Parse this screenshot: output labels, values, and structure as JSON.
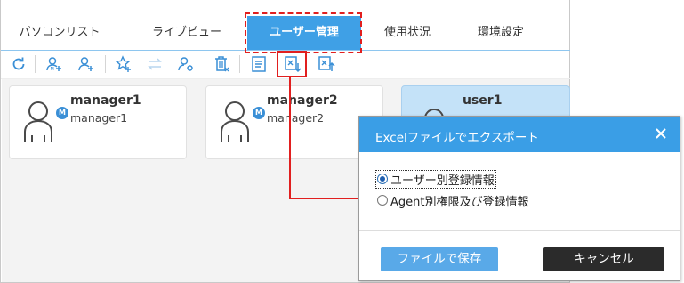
{
  "tabs": [
    {
      "label": "パソコンリスト",
      "active": false
    },
    {
      "label": "ライブビュー",
      "active": false
    },
    {
      "label": "ユーザー管理",
      "active": true
    },
    {
      "label": "使用状況",
      "active": false
    },
    {
      "label": "環境設定",
      "active": false
    }
  ],
  "toolbar": {
    "icons": [
      "refresh-icon",
      "add-manager-icon",
      "add-user-icon",
      "favorite-icon",
      "transfer-icon",
      "user-settings-icon",
      "delete-icon",
      "list-icon",
      "export-excel-icon",
      "import-excel-icon"
    ]
  },
  "cards": [
    {
      "name": "manager1",
      "sub": "manager1",
      "badge": "M",
      "selected": false
    },
    {
      "name": "manager2",
      "sub": "manager2",
      "badge": "M",
      "selected": false
    },
    {
      "name": "user1",
      "sub": "",
      "badge": "",
      "selected": true
    }
  ],
  "dialog": {
    "title": "Excelファイルでエクスポート",
    "options": [
      {
        "label": "ユーザー別登録情報",
        "checked": true
      },
      {
        "label": "Agent別権限及び登録情報",
        "checked": false
      }
    ],
    "save_label": "ファイルで保存",
    "cancel_label": "キャンセル"
  },
  "colors": {
    "accent": "#3fa0e6",
    "highlight": "#e11f1f",
    "selected_card": "#c4e2f8",
    "cancel_button": "#2b2b2b"
  }
}
